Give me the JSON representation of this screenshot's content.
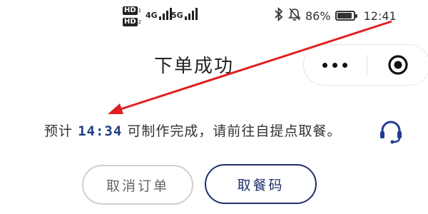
{
  "status_bar": {
    "hd1": "HD",
    "hd1_sub": "1",
    "hd2": "HD",
    "hd2_sub": "2",
    "net1": "4G",
    "net2": "5G",
    "battery_percent": "86%",
    "battery_level": 0.86,
    "time": "12:41"
  },
  "page": {
    "title": "下单成功"
  },
  "message": {
    "prefix": "预计",
    "time": "14:34",
    "suffix": "可制作完成，请前往自提点取餐。"
  },
  "buttons": {
    "cancel": "取消订单",
    "pickup_code": "取餐码"
  },
  "colors": {
    "accent": "#1f2f6b",
    "arrow": "#e02020",
    "time_text": "#1f3f7f"
  },
  "icons": [
    "bluetooth-icon",
    "mute-bell-icon",
    "battery-icon",
    "more-icon",
    "close-mini-program-icon",
    "customer-service-icon"
  ]
}
